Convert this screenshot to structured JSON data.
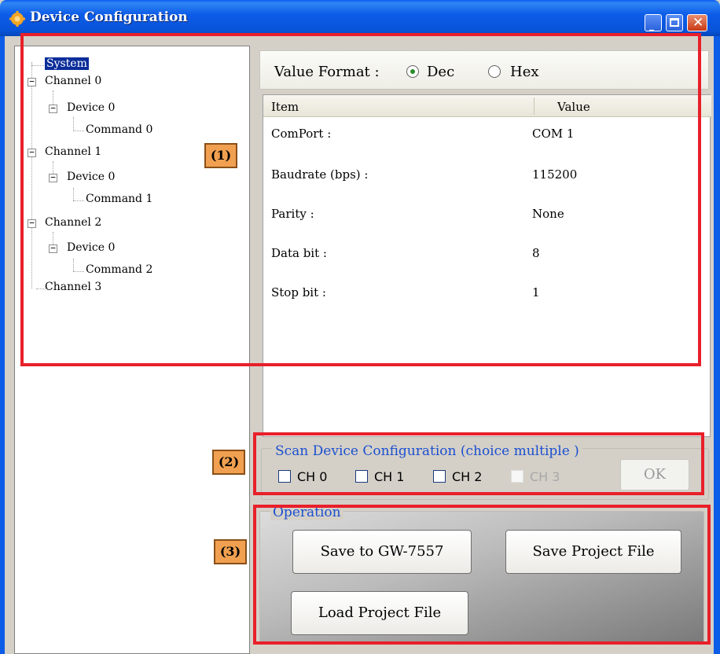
{
  "window": {
    "title": "Device Configuration"
  },
  "tree": {
    "items": [
      {
        "label": "System",
        "selected": true
      },
      {
        "label": "Channel 0"
      },
      {
        "label": "Device 0"
      },
      {
        "label": "Command 0"
      },
      {
        "label": "Channel 1"
      },
      {
        "label": "Device 0"
      },
      {
        "label": "Command 1"
      },
      {
        "label": "Channel 2"
      },
      {
        "label": "Device 0"
      },
      {
        "label": "Command 2"
      },
      {
        "label": "Channel 3"
      }
    ]
  },
  "value_format": {
    "label": "Value Format :",
    "options": [
      "Dec",
      "Hex"
    ],
    "selected": "Dec"
  },
  "grid": {
    "columns": [
      "Item",
      "Value"
    ],
    "rows": [
      {
        "item": "ComPort :",
        "value": "COM 1"
      },
      {
        "item": "Baudrate (bps) :",
        "value": "115200"
      },
      {
        "item": "Parity :",
        "value": "None"
      },
      {
        "item": "Data bit :",
        "value": "8"
      },
      {
        "item": "Stop bit :",
        "value": "1"
      }
    ]
  },
  "scan": {
    "title": "Scan Device Configuration (choice multiple )",
    "channels": [
      {
        "label": "CH 0",
        "enabled": true
      },
      {
        "label": "CH 1",
        "enabled": true
      },
      {
        "label": "CH 2",
        "enabled": true
      },
      {
        "label": "CH 3",
        "enabled": false
      }
    ],
    "ok_label": "OK"
  },
  "operation": {
    "title": "Operation",
    "save_device_label": "Save to GW-7557",
    "save_project_label": "Save Project File",
    "load_project_label": "Load Project File"
  },
  "annotations": {
    "tag1": "(1)",
    "tag2": "(2)",
    "tag3": "(3)",
    "highlight_color": "#e8202a",
    "tag_color": "#f0a050"
  },
  "colors": {
    "titlebar": "#0b5ce6",
    "group_title": "#1a4fd0",
    "selection": "#0a2d9a"
  }
}
